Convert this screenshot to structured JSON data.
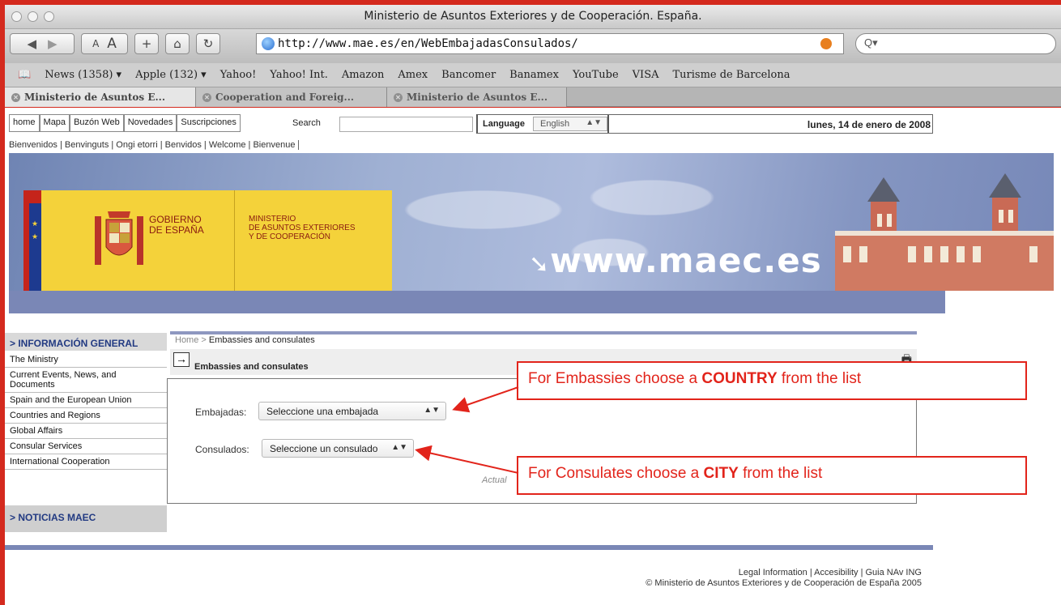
{
  "window": {
    "title": "Ministerio de Asuntos Exteriores y de Cooperación. España."
  },
  "toolbar": {
    "smaller_text": "A",
    "bigger_text": "A",
    "add": "+",
    "home": "⌂",
    "reload": "↻",
    "url": "http://www.mae.es/en/WebEmbajadasConsulados/",
    "search_placeholder": "Q▾"
  },
  "bookmarks": [
    "News (1358) ▾",
    "Apple (132) ▾",
    "Yahoo!",
    "Yahoo! Int.",
    "Amazon",
    "Amex",
    "Bancomer",
    "Banamex",
    "YouTube",
    "VISA",
    "Turisme de Barcelona"
  ],
  "tabs": [
    {
      "label": "Ministerio de Asuntos E..."
    },
    {
      "label": "Cooperation and Foreig..."
    },
    {
      "label": "Ministerio de Asuntos E..."
    }
  ],
  "topnav": [
    "home",
    "Mapa",
    "Buzón Web",
    "Novedades",
    "Suscripciones"
  ],
  "search_label": "Search",
  "language": {
    "label": "Language",
    "value": "English"
  },
  "date": "lunes, 14 de enero de 2008",
  "welcome": "Bienvenidos | Benvinguts | Ongi etorri | Benvidos | Welcome | Bienvenue",
  "banner": {
    "gov_line1": "GOBIERNO",
    "gov_line2": "DE ESPAÑA",
    "ministry_line1": "MINISTERIO",
    "ministry_line2": "DE ASUNTOS EXTERIORES",
    "ministry_line3": "Y DE COOPERACIÓN",
    "site": "www.maec.es"
  },
  "leftnav": {
    "heading": "> INFORMACIÓN GENERAL",
    "items": [
      "The Ministry",
      "Current Events, News, and Documents",
      "Spain and the European Union",
      "Countries and Regions",
      "Global Affairs",
      "Consular Services",
      "International Cooperation"
    ],
    "news_heading": "> NOTICIAS MAEC"
  },
  "content": {
    "crumb_home": "Home >",
    "crumb_current": "Embassies and consulates",
    "title": "Embassies and consulates",
    "embajadas_label": "Embajadas:",
    "embajadas_value": "Seleccione una embajada",
    "consulados_label": "Consulados:",
    "consulados_value": "Seleccione un consulado",
    "actual": "Actual"
  },
  "footer": {
    "links": "Legal Information | Accesibility | Guia NAv ING",
    "copyright": "© Ministerio de Asuntos Exteriores y de Cooperación de España 2005"
  },
  "callouts": {
    "embassy_pre": "For Embassies choose a ",
    "embassy_bold": "COUNTRY",
    "embassy_post": " from the list",
    "consulate_pre": "For Consulates choose a ",
    "consulate_bold": "CITY",
    "consulate_post": " from the list"
  },
  "colors": {
    "frame": "#d42a1e",
    "annotation": "#e2241b",
    "bar": "#7a87b6",
    "nav_heading": "#223a82"
  }
}
